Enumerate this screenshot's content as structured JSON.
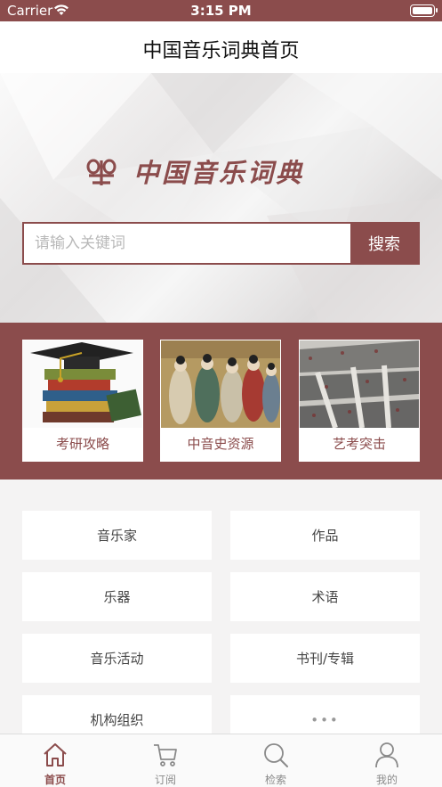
{
  "status_bar": {
    "carrier": "Carrier",
    "time": "3:15 PM"
  },
  "nav": {
    "title": "中国音乐词典首页"
  },
  "hero": {
    "logo_text": "中国音乐词典",
    "search": {
      "placeholder": "请输入关键词",
      "button_label": "搜索"
    }
  },
  "features": [
    {
      "label": "考研攻略"
    },
    {
      "label": "中音史资源"
    },
    {
      "label": "艺考突击"
    }
  ],
  "categories": [
    {
      "label": "音乐家"
    },
    {
      "label": "作品"
    },
    {
      "label": "乐器"
    },
    {
      "label": "术语"
    },
    {
      "label": "音乐活动"
    },
    {
      "label": "书刊/专辑"
    },
    {
      "label": "机构组织"
    },
    {
      "label": "•••"
    }
  ],
  "tabs": [
    {
      "label": "首页",
      "icon": "home-icon",
      "active": true
    },
    {
      "label": "订阅",
      "icon": "cart-icon",
      "active": false
    },
    {
      "label": "检索",
      "icon": "search-icon",
      "active": false
    },
    {
      "label": "我的",
      "icon": "user-icon",
      "active": false
    }
  ],
  "colors": {
    "brand": "#8b4c4c",
    "background": "#f4f3f3",
    "tab_inactive": "#8a8a8a"
  }
}
